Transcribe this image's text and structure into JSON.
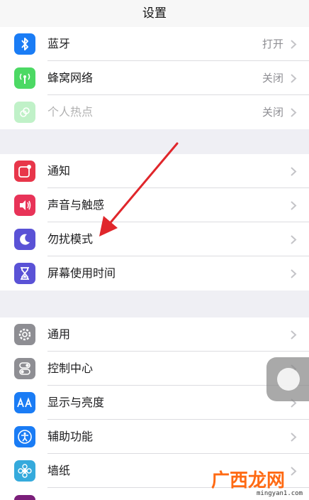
{
  "header": {
    "title": "设置"
  },
  "group1": [
    {
      "label": "蓝牙",
      "value": "打开",
      "icon": "bluetooth-icon",
      "color": "#1a7cf5"
    },
    {
      "label": "蜂窝网络",
      "value": "关闭",
      "icon": "cellular-icon",
      "color": "#4cd964"
    },
    {
      "label": "个人热点",
      "value": "关闭",
      "icon": "hotspot-icon",
      "color": "#4cd964"
    }
  ],
  "group2": [
    {
      "label": "通知",
      "icon": "notifications-icon",
      "color": "#e8364a"
    },
    {
      "label": "声音与触感",
      "icon": "sound-icon",
      "color": "#e83358"
    },
    {
      "label": "勿扰模式",
      "icon": "moon-icon",
      "color": "#5a52d6"
    },
    {
      "label": "屏幕使用时间",
      "icon": "hourglass-icon",
      "color": "#5a52d6"
    }
  ],
  "group3": [
    {
      "label": "通用",
      "icon": "gear-icon",
      "color": "#8e8e93"
    },
    {
      "label": "控制中心",
      "icon": "toggles-icon",
      "color": "#8e8e93"
    },
    {
      "label": "显示与亮度",
      "icon": "text-size-icon",
      "color": "#1a7cf5"
    },
    {
      "label": "辅助功能",
      "icon": "accessibility-icon",
      "color": "#1a7cf5"
    },
    {
      "label": "墙纸",
      "icon": "wallpaper-icon",
      "color": "#35aadc"
    }
  ],
  "watermark": {
    "logo_text": "广西龙网",
    "url": "mingyan1.com"
  }
}
